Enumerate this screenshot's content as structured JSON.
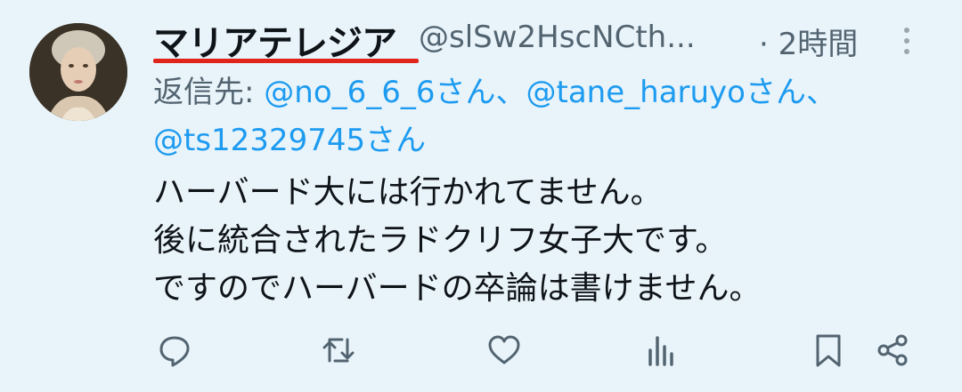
{
  "tweet": {
    "display_name": "マリアテレジア",
    "handle": "@slSw2HscNCth...",
    "time": "· 2時間",
    "reply_prefix": "返信先: ",
    "mentions": [
      "@no_6_6_6さん、",
      "@tane_haruyoさん、",
      "@ts12329745さん"
    ],
    "body_lines": [
      "ハーバード大には行かれてません。",
      "後に統合されたラドクリフ女子大です。",
      "ですのでハーバードの卒論は書けません。"
    ]
  },
  "icons": {
    "more": "more-vertical-icon",
    "reply": "reply-icon",
    "retweet": "retweet-icon",
    "like": "heart-icon",
    "views": "views-icon",
    "bookmark": "bookmark-icon",
    "share": "share-icon"
  },
  "colors": {
    "background": "#e9f4fa",
    "mention": "#1d9bf0",
    "secondary_text": "#536471",
    "underline": "#e0241b"
  }
}
